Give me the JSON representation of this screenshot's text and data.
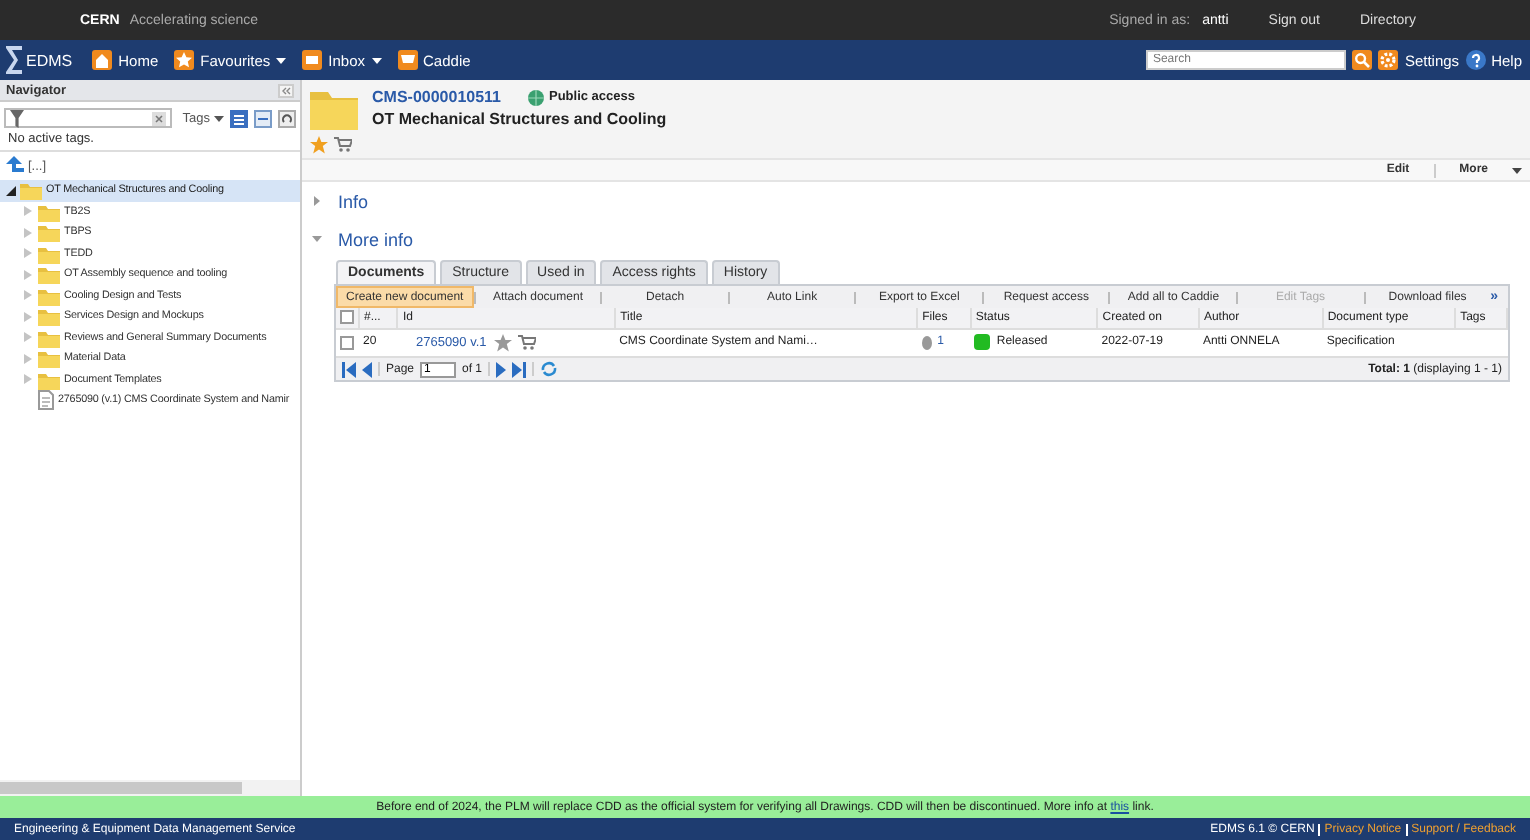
{
  "topbar": {
    "brand": "CERN",
    "tagline": "Accelerating science",
    "signed_in_label": "Signed in as:",
    "user": "antti",
    "links": [
      "Sign out",
      "Directory"
    ]
  },
  "navbar": {
    "logo": "EDMS",
    "items": [
      {
        "label": "Home",
        "dropdown": false
      },
      {
        "label": "Favourites",
        "dropdown": true
      },
      {
        "label": "Inbox",
        "dropdown": true
      },
      {
        "label": "Caddie",
        "dropdown": false
      }
    ],
    "search": {
      "placeholder": "Search"
    },
    "settings": "Settings",
    "help": "Help"
  },
  "navigator": {
    "title": "Navigator",
    "tags_label": "Tags",
    "no_tags": "No active tags.",
    "up": "[...]",
    "tree": [
      {
        "label": "OT Mechanical Structures and Cooling",
        "kind": "folder",
        "expanded": true,
        "selected": true,
        "children": [
          {
            "label": "TB2S",
            "kind": "folder",
            "expanded": false,
            "selected": false
          },
          {
            "label": "TBPS",
            "kind": "folder",
            "expanded": false,
            "selected": false
          },
          {
            "label": "TEDD",
            "kind": "folder",
            "expanded": false,
            "selected": false
          },
          {
            "label": "OT Assembly sequence and tooling",
            "kind": "folder",
            "expanded": false,
            "selected": false
          },
          {
            "label": "Cooling Design and Tests",
            "kind": "folder",
            "expanded": false,
            "selected": false
          },
          {
            "label": "Services Design and Mockups",
            "kind": "folder",
            "expanded": false,
            "selected": false
          },
          {
            "label": "Reviews and General Summary Documents",
            "kind": "folder",
            "expanded": false,
            "selected": false
          },
          {
            "label": "Material Data",
            "kind": "folder",
            "expanded": false,
            "selected": false
          },
          {
            "label": "Document Templates",
            "kind": "folder",
            "expanded": false,
            "selected": false
          },
          {
            "label": "2765090 (v.1) CMS Coordinate System and Namir",
            "kind": "document",
            "selected": false
          }
        ]
      }
    ]
  },
  "header": {
    "code": "CMS-0000010511",
    "access": "Public access",
    "title": "OT Mechanical Structures and Cooling",
    "favourite": true
  },
  "actions": [
    {
      "label": "Edit",
      "dropdown": false
    },
    {
      "label": "More",
      "dropdown": true
    }
  ],
  "sections": [
    {
      "label": "Info",
      "expanded": false
    },
    {
      "label": "More info",
      "expanded": true
    }
  ],
  "tabs": [
    {
      "label": "Documents",
      "selected": true
    },
    {
      "label": "Structure",
      "selected": false
    },
    {
      "label": "Used in",
      "selected": false
    },
    {
      "label": "Access rights",
      "selected": false
    },
    {
      "label": "History",
      "selected": false
    }
  ],
  "toolbar": [
    {
      "label": "Create new document",
      "highlighted": true,
      "disabled": false
    },
    {
      "label": "Attach document",
      "highlighted": false,
      "disabled": false
    },
    {
      "label": "Detach",
      "highlighted": false,
      "disabled": false
    },
    {
      "label": "Auto Link",
      "highlighted": false,
      "disabled": false
    },
    {
      "label": "Export to Excel",
      "highlighted": false,
      "disabled": false
    },
    {
      "label": "Request access",
      "highlighted": false,
      "disabled": false
    },
    {
      "label": "Add all to Caddie",
      "highlighted": false,
      "disabled": false
    },
    {
      "label": "Edit Tags",
      "highlighted": false,
      "disabled": true
    },
    {
      "label": "Download files",
      "highlighted": false,
      "disabled": false
    }
  ],
  "overflow": "»",
  "table": {
    "select_all_checked": false,
    "columns": [
      "#...",
      "Id",
      "Title",
      "Files",
      "Status",
      "Created on",
      "Author",
      "Document type",
      "Tags"
    ],
    "rows": [
      {
        "checked": false,
        "number": "20",
        "id": "2765090 v.1",
        "title": "CMS Coordinate System and Nami…",
        "files": "1",
        "status": "Released",
        "color": "#22bb22",
        "created": "2022-07-19",
        "author": "Antti ONNELA",
        "type": "Specification"
      }
    ]
  },
  "paging": {
    "page_label": "Page",
    "page": "1",
    "of": "of 1",
    "total": "**Total: 1** (displaying 1 - 1)"
  },
  "banner": {
    "text": "Before end of 2024, the PLM will replace CDD as the official system for verifying all Drawings. CDD will then be discontinued. More info at",
    "link": "this",
    "after": "link."
  },
  "footer": {
    "service": "Engineering & Equipment Data Management Service",
    "version": "EDMS 6.1 © CERN",
    "links": [
      "Privacy Notice",
      "Support / Feedback"
    ]
  }
}
